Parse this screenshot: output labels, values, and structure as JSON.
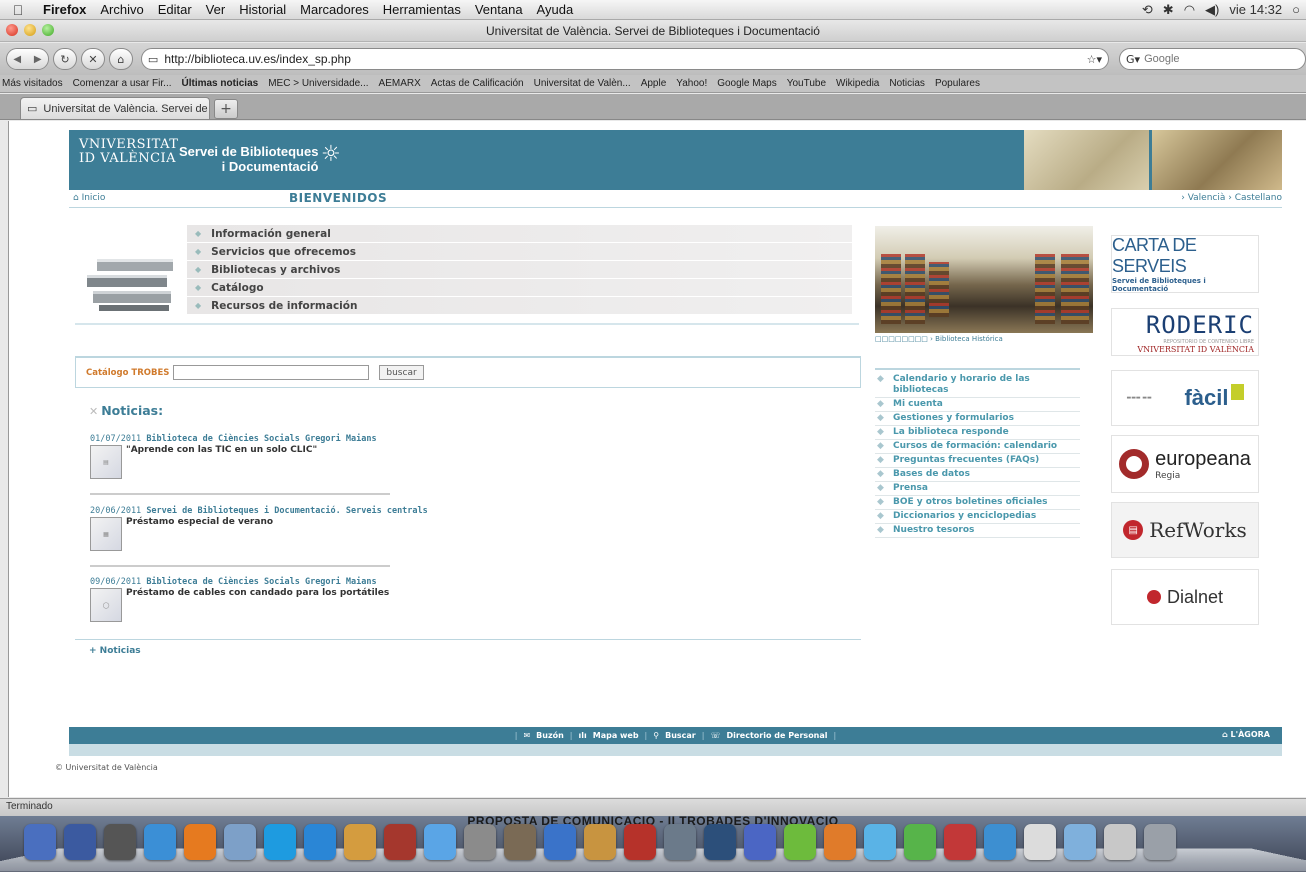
{
  "menubar": {
    "apple": "",
    "items": [
      "Firefox",
      "Archivo",
      "Editar",
      "Ver",
      "Historial",
      "Marcadores",
      "Herramientas",
      "Ventana",
      "Ayuda"
    ],
    "clock": "vie 14:32"
  },
  "window": {
    "title": "Universitat de València. Servei de Biblioteques i Documentació"
  },
  "toolbar": {
    "url": "http://biblioteca.uv.es/index_sp.php",
    "search_placeholder": "Google"
  },
  "bookmarks": [
    "Más visitados",
    "Comenzar a usar Fir...",
    "Últimas noticias",
    "MEC > Universidade...",
    "AEMARX",
    "Actas de Calificación",
    "Universitat de Valèn...",
    "Apple",
    "Yahoo!",
    "Google Maps",
    "YouTube",
    "Wikipedia",
    "Noticias",
    "Populares"
  ],
  "tab": {
    "label": "Universitat de València. Servei de ...",
    "new_tab": "+"
  },
  "header": {
    "uv_line1": "VNIVERSITAT",
    "uv_line2": "ID VALÈNCIA",
    "sbd_line1": "Servei de Biblioteques",
    "sbd_line2": "i Documentació"
  },
  "subnav": {
    "inicio": "Inicio",
    "title": "BIENVENIDOS",
    "langs": "› Valencià › Castellano"
  },
  "mainmenu": [
    "Información general",
    "Servicios que ofrecemos",
    "Bibliotecas y archivos",
    "Catálogo",
    "Recursos de información"
  ],
  "libphoto": {
    "caption": "□□□□□□□□ › Biblioteca Histórica"
  },
  "trobes": {
    "label": "Catálogo TROBES",
    "button": "buscar"
  },
  "news": {
    "heading": "Noticias:",
    "items": [
      {
        "date": "01/07/2011",
        "source": "Biblioteca de Ciències Socials Gregori Maians",
        "title": "\"Aprende con las TIC en un solo CLIC\""
      },
      {
        "date": "20/06/2011",
        "source": "Servei de Biblioteques i Documentació. Serveis centrals",
        "title": "Préstamo especial de verano"
      },
      {
        "date": "09/06/2011",
        "source": "Biblioteca de Ciències Socials Gregori Maians",
        "title": "Préstamo de cables con candado para los portátiles"
      }
    ],
    "more": "+ Noticias"
  },
  "links": [
    "Calendario y horario de las bibliotecas",
    "Mi cuenta",
    "Gestiones y formularios",
    "La biblioteca responde",
    "Cursos de formación: calendario",
    "Preguntas frecuentes (FAQs)",
    "Bases de datos",
    "Prensa",
    "BOE y otros boletines oficiales",
    "Diccionarios y enciclopedias",
    "Nuestro tesoros"
  ],
  "banners": {
    "carta": "CARTA DE SERVEIS",
    "carta_sub": "Servei de Biblioteques i Documentació",
    "roderic": "RODERIC",
    "roderic_sub": "REPOSITORIO DE CONTENIDO LIBRE",
    "roderic_uv": "VNIVERSITAT ID VALÈNCIA",
    "facil": "fàcil",
    "europeana": "europeana",
    "europeana_sub": "Regia",
    "refworks": "RefWorks",
    "dialnet": "Dialnet"
  },
  "footer": {
    "buzon": "Buzón",
    "mapa": "Mapa web",
    "buscar": "Buscar",
    "directorio": "Directorio de Personal",
    "agora": "L'ÀGORA",
    "copyright": "© Universitat de València"
  },
  "status": "Terminado",
  "dock": {
    "ribbon": "PROPOSTA DE COMUNICACIÓ - II TROBADES D'INNOVACIÓ"
  },
  "colors": {
    "brand": "#3d7d96",
    "accent": "#d07a2c",
    "link": "#4a98ac"
  }
}
